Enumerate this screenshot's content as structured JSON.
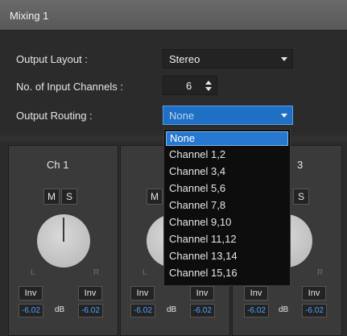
{
  "window": {
    "title": "Mixing 1"
  },
  "settings": {
    "output_layout": {
      "label": "Output Layout :",
      "value": "Stereo"
    },
    "input_channels": {
      "label": "No. of Input Channels :",
      "value": "6"
    },
    "output_routing": {
      "label": "Output Routing :",
      "value": "None"
    }
  },
  "routing_dropdown": {
    "options": [
      "None",
      "Channel 1,2",
      "Channel 3,4",
      "Channel 5,6",
      "Channel 7,8",
      "Channel 9,10",
      "Channel 11,12",
      "Channel 13,14",
      "Channel 15,16"
    ],
    "selected": "None"
  },
  "strips": [
    {
      "name": "Ch 1",
      "mute": "M",
      "solo": "S",
      "left_label": "L",
      "right_label": "R",
      "inv_left": "Inv",
      "inv_right": "Inv",
      "db_left": "-6.02",
      "db_unit": "dB",
      "db_right": "-6.02"
    },
    {
      "name": "",
      "mute": "M",
      "solo": "",
      "left_label": "L",
      "right_label": "",
      "inv_left": "Inv",
      "inv_right": "Inv",
      "db_left": "-6.02",
      "db_unit": "dB",
      "db_right": "-6.02"
    },
    {
      "name": "3",
      "mute": "",
      "solo": "S",
      "left_label": "",
      "right_label": "R",
      "inv_left": "Inv",
      "inv_right": "Inv",
      "db_left": "-6.02",
      "db_unit": "dB",
      "db_right": "-6.02"
    }
  ]
}
